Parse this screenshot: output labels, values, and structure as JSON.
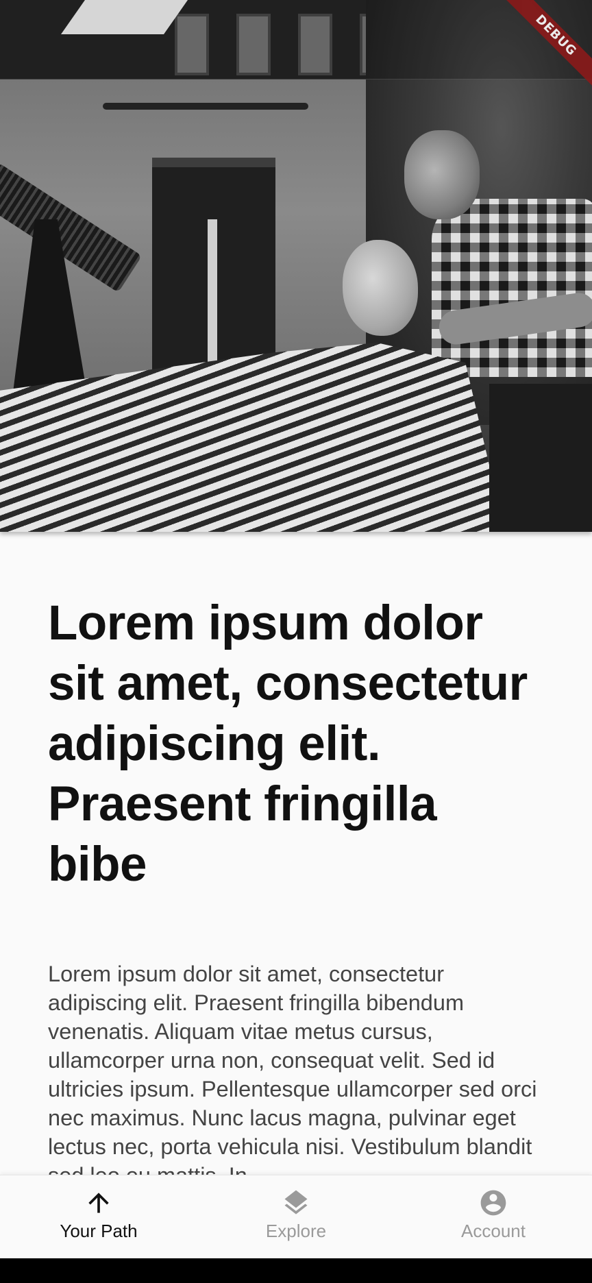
{
  "debug_banner": "DEBUG",
  "article": {
    "title": "Lorem ipsum dolor sit amet, consectetur adipiscing elit. Praesent fringilla bibe",
    "body": "Lorem ipsum dolor sit amet, consectetur adipiscing elit. Praesent fringilla bibendum venenatis. Aliquam vitae metus cursus, ullamcorper urna non, consequat velit. Sed id ultricies ipsum. Pellentesque ullamcorper sed orci nec maximus. Nunc lacus magna, pulvinar eget lectus nec, porta vehicula nisi. Vestibulum blandit sed leo eu mattis. In"
  },
  "bottom_nav": {
    "items": [
      {
        "label": "Your Path",
        "icon": "arrow-up-icon",
        "active": true
      },
      {
        "label": "Explore",
        "icon": "layers-icon",
        "active": false
      },
      {
        "label": "Account",
        "icon": "account-circle-icon",
        "active": false
      }
    ]
  },
  "colors": {
    "active": "#111111",
    "inactive": "#9a9a9a",
    "debug_ribbon": "#8b1a1a"
  }
}
